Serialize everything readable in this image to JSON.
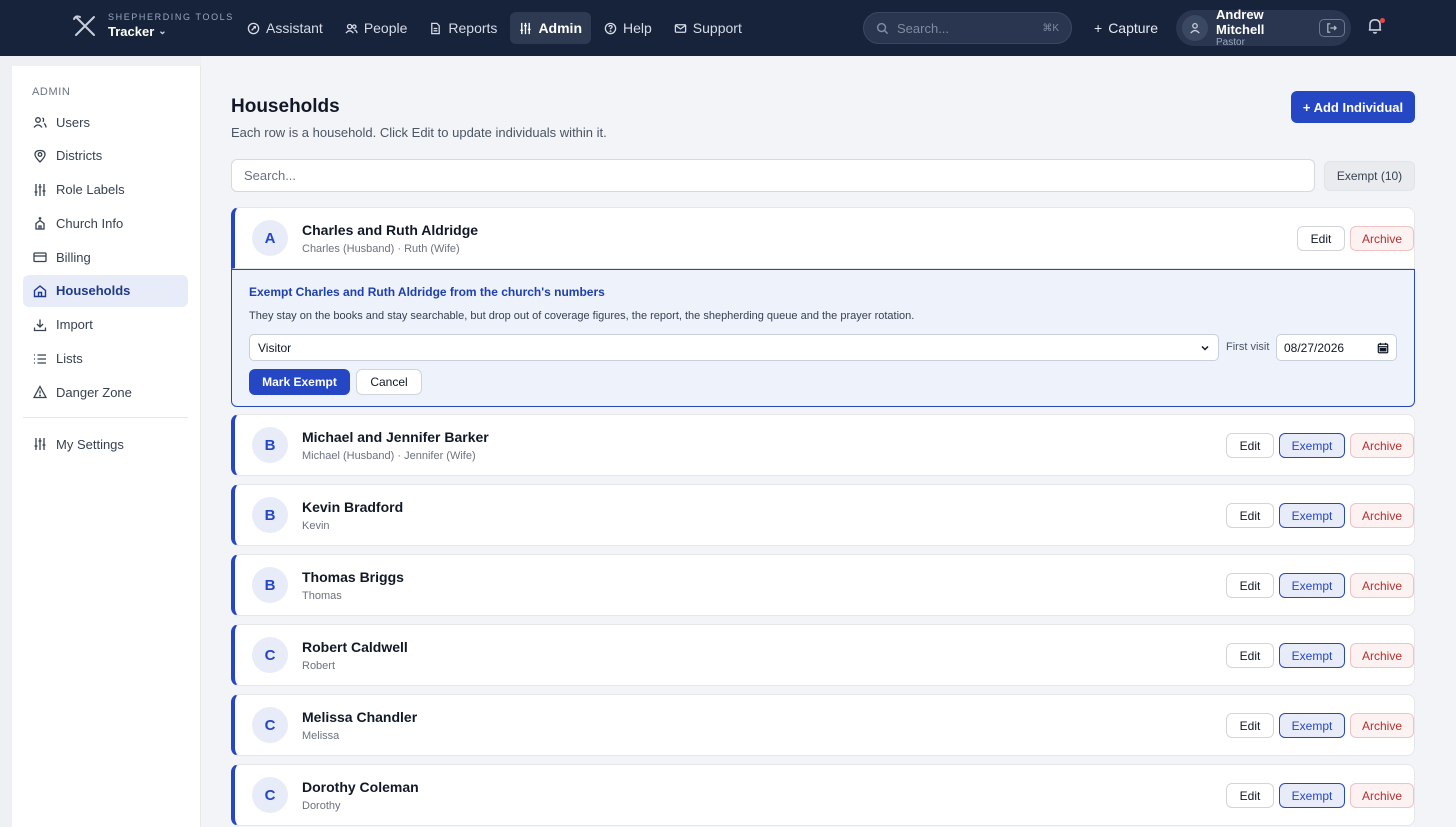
{
  "brand": {
    "kicker": "SHEPHERDING TOOLS",
    "name": "Tracker"
  },
  "nav": [
    {
      "label": "Assistant",
      "icon": "assistant-icon"
    },
    {
      "label": "People",
      "icon": "people-icon"
    },
    {
      "label": "Reports",
      "icon": "reports-icon"
    },
    {
      "label": "Admin",
      "icon": "admin-icon",
      "active": true
    },
    {
      "label": "Help",
      "icon": "help-icon"
    },
    {
      "label": "Support",
      "icon": "support-icon"
    }
  ],
  "global_search": {
    "placeholder": "Search...",
    "shortcut": "⌘K"
  },
  "capture_label": "Capture",
  "user": {
    "name": "Andrew Mitchell",
    "role": "Pastor"
  },
  "sidebar": {
    "heading": "ADMIN",
    "items": [
      {
        "label": "Users",
        "icon": "users-icon"
      },
      {
        "label": "Districts",
        "icon": "map-pin-icon"
      },
      {
        "label": "Role Labels",
        "icon": "sliders-icon"
      },
      {
        "label": "Church Info",
        "icon": "church-icon"
      },
      {
        "label": "Billing",
        "icon": "credit-card-icon"
      },
      {
        "label": "Households",
        "icon": "home-icon",
        "active": true
      },
      {
        "label": "Import",
        "icon": "download-icon"
      },
      {
        "label": "Lists",
        "icon": "list-icon"
      },
      {
        "label": "Danger Zone",
        "icon": "warning-icon"
      }
    ],
    "settings_label": "My Settings"
  },
  "page": {
    "title": "Households",
    "subtitle": "Each row is a household. Click Edit to update individuals within it.",
    "add_button": "+ Add Individual",
    "search_placeholder": "Search...",
    "exempt_filter": "Exempt (10)"
  },
  "actions": {
    "edit": "Edit",
    "exempt": "Exempt",
    "archive": "Archive"
  },
  "exempt_panel": {
    "title": "Exempt Charles and Ruth Aldridge from the church's numbers",
    "description": "They stay on the books and stay searchable, but drop out of coverage figures, the report, the shepherding queue and the prayer rotation.",
    "reason_value": "Visitor",
    "date_label": "First visit",
    "date_value": "08/27/2026",
    "mark_button": "Mark Exempt",
    "cancel_button": "Cancel"
  },
  "households": [
    {
      "letter": "A",
      "name": "Charles and Ruth Aldridge",
      "members": "Charles (Husband) · Ruth (Wife)"
    },
    {
      "letter": "B",
      "name": "Michael and Jennifer Barker",
      "members": "Michael (Husband) · Jennifer (Wife)"
    },
    {
      "letter": "B",
      "name": "Kevin Bradford",
      "members": "Kevin"
    },
    {
      "letter": "B",
      "name": "Thomas Briggs",
      "members": "Thomas"
    },
    {
      "letter": "C",
      "name": "Robert Caldwell",
      "members": "Robert"
    },
    {
      "letter": "C",
      "name": "Melissa Chandler",
      "members": "Melissa"
    },
    {
      "letter": "C",
      "name": "Dorothy Coleman",
      "members": "Dorothy"
    }
  ],
  "colors": {
    "topbar": "#17233a",
    "accent": "#2547c4",
    "danger": "#b4302d"
  }
}
